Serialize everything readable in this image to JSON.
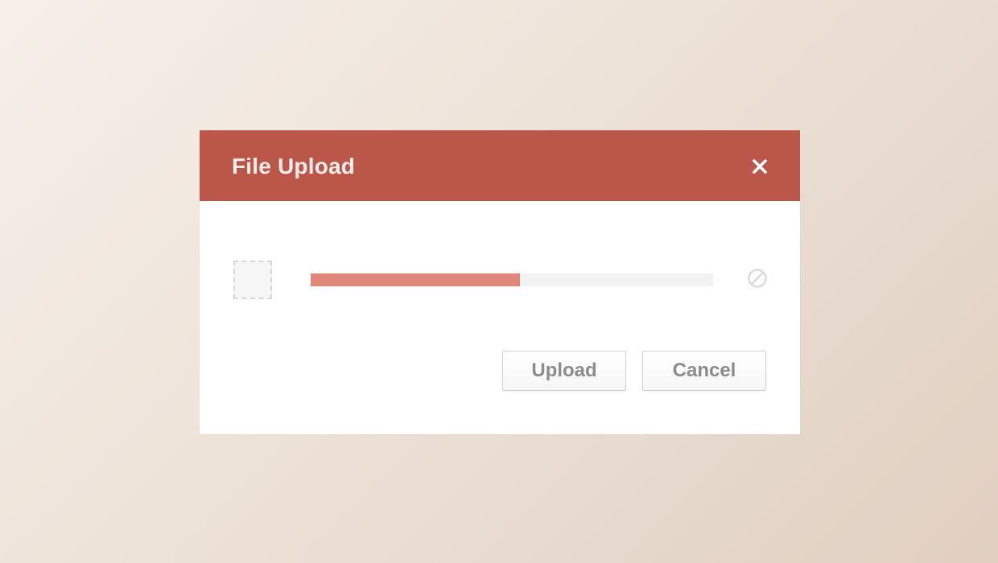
{
  "dialog": {
    "title": "File Upload",
    "close_icon": "close-icon",
    "header_color": "#bb5749"
  },
  "upload": {
    "file_icon": "file-placeholder-icon",
    "progress": 0.52,
    "progress_color": "#df877b",
    "cancel_icon": "cancel-icon"
  },
  "buttons": {
    "upload_label": "Upload",
    "cancel_label": "Cancel"
  }
}
